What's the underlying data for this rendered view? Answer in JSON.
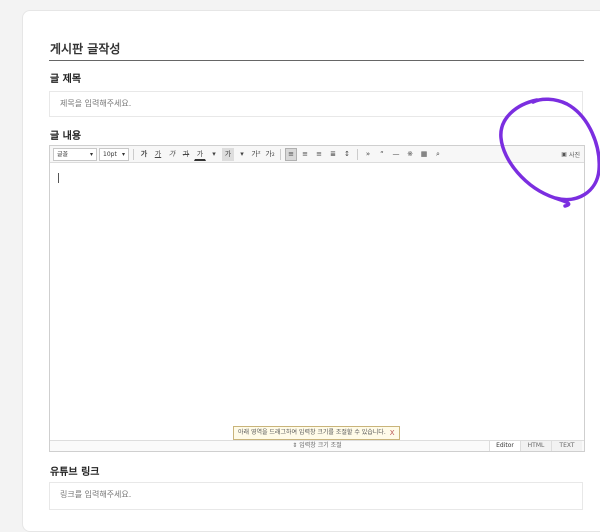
{
  "page": {
    "heading": "게시판 글작성",
    "title_label": "글 제목",
    "title_placeholder": "제목을 입력해주세요.",
    "content_label": "글 내용",
    "youtube_label": "유튜브 링크",
    "youtube_placeholder": "링크를 입력해주세요."
  },
  "editor": {
    "font_select": "글꼴",
    "size_select": "10pt",
    "toolbar_buttons": [
      "가",
      "가",
      "가",
      "가",
      "가",
      "가",
      "가",
      "가²",
      "가₂"
    ],
    "photo_button": "사진",
    "resize_label": "입력창 크기 조절",
    "tooltip": "아래 영역을 드래그하여 입력창 크기를 조절할 수 있습니다.",
    "tooltip_close": "X",
    "modes": [
      "Editor",
      "HTML",
      "TEXT"
    ],
    "align_icons": [
      "align-left-icon",
      "align-center-icon",
      "align-right-icon",
      "align-justify-icon"
    ]
  },
  "annotation": {
    "color": "#7b2ee0"
  }
}
